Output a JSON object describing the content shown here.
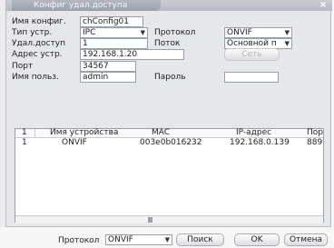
{
  "dialog": {
    "title": "Конфиг удал.доступа",
    "close_glyph": "×"
  },
  "form": {
    "config_name": {
      "label": "Имя конфиг.",
      "value": "chConfig01"
    },
    "device_type": {
      "label": "Тип устр.",
      "value": "IPC"
    },
    "protocol": {
      "label": "Протокол",
      "value": "ONVIF"
    },
    "remote_access": {
      "label": "Удал.доступ",
      "value": "1"
    },
    "stream": {
      "label": "Поток",
      "value": "Основной п"
    },
    "device_address": {
      "label": "Адрес устр.",
      "value": "192.168.1.20"
    },
    "network_button": "Сеть",
    "port": {
      "label": "Порт",
      "value": "34567"
    },
    "username": {
      "label": "Имя польз.",
      "value": "admin"
    },
    "password": {
      "label": "Пароль",
      "value": ""
    }
  },
  "device_list": {
    "columns": [
      "1",
      "Имя устройства",
      "MAC",
      "IP-адрес",
      "Пор"
    ],
    "rows": [
      {
        "index": "1",
        "name": "ONVIF",
        "mac": "003e0b016232",
        "ip": "192.168.0.139",
        "port": "889"
      }
    ]
  },
  "footer": {
    "protocol_label": "Протокол",
    "protocol_value": "ONVIF",
    "search_button": "Поиск",
    "ok_button": "OK",
    "cancel_button": "Отмена"
  },
  "colors": {
    "title_text": "#f6f6f6",
    "window_bg": "#e6e7ea"
  }
}
